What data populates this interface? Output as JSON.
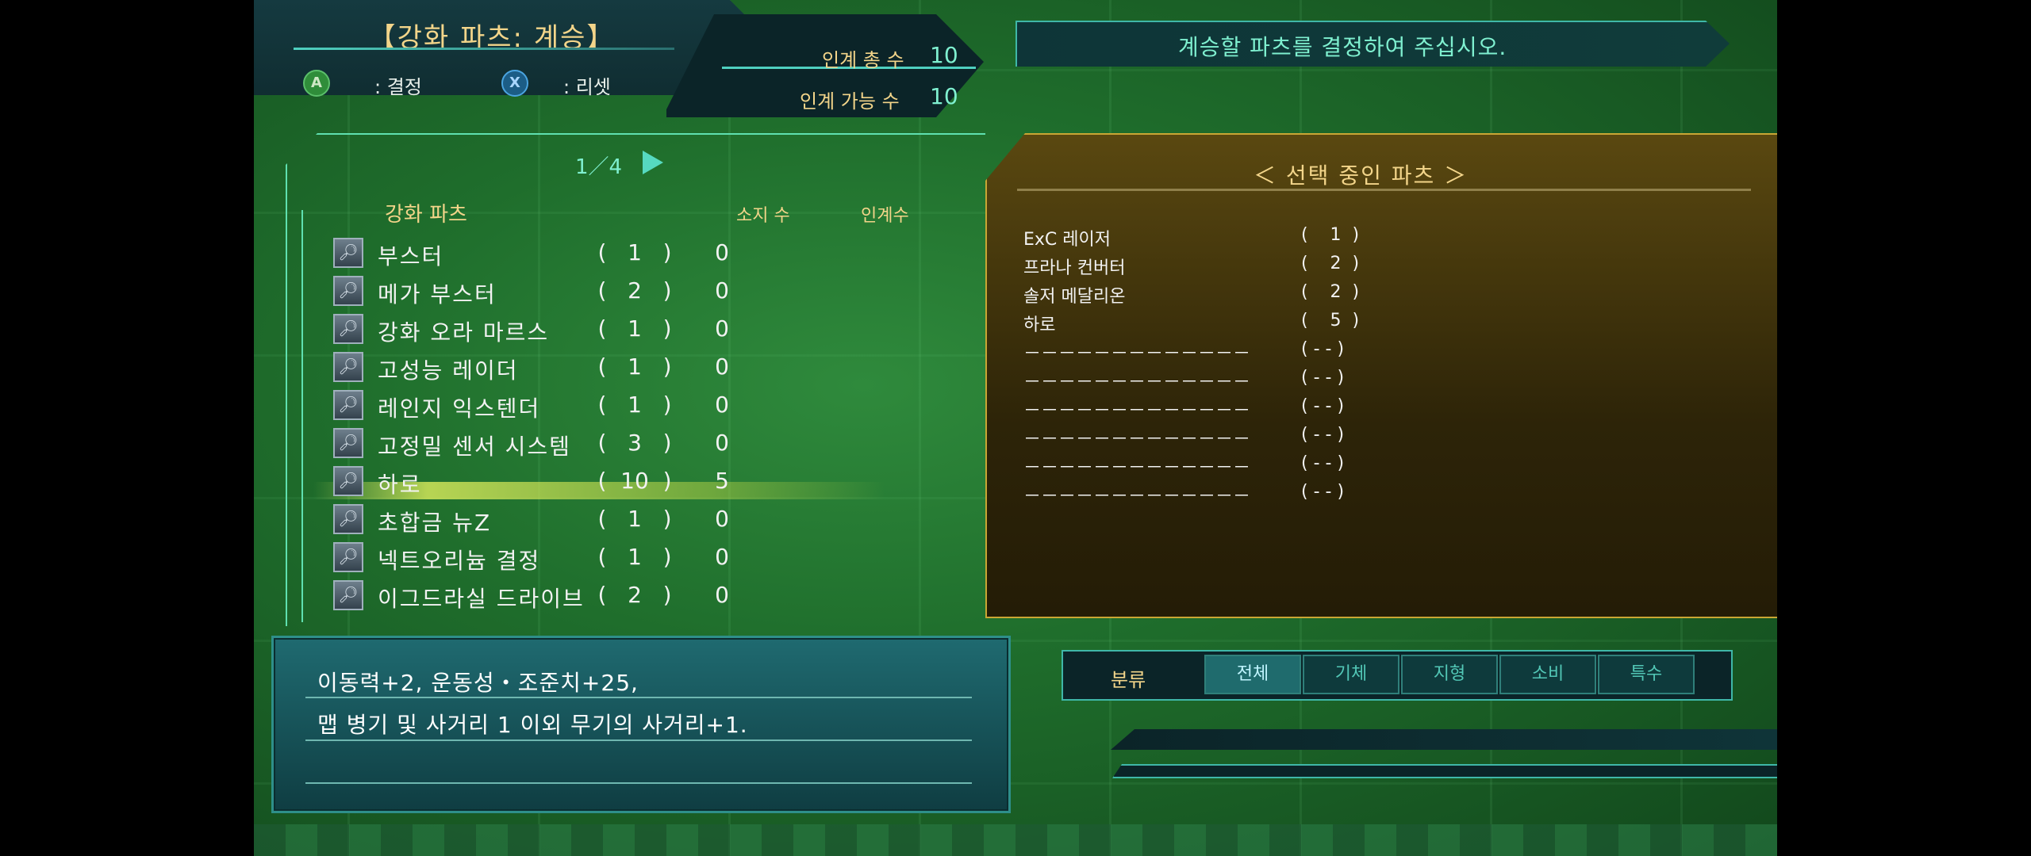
{
  "header": {
    "title": "【강화 파츠: 계승】",
    "controls": [
      {
        "button": "A",
        "label": ": 결정"
      },
      {
        "button": "X",
        "label": ": 리셋"
      }
    ],
    "total_label": "인계 총 수",
    "total_value": "10",
    "avail_label": "인계 가능 수",
    "avail_value": "10",
    "message": "계승할 파츠를 결정하여 주십시오."
  },
  "list": {
    "page": "1／4",
    "col_parts": "강화 파츠",
    "col_owned": "소지 수",
    "col_inherit": "인계수",
    "rows": [
      {
        "name": "부스터",
        "owned": "(   1   )",
        "inherit": "0"
      },
      {
        "name": "메가 부스터",
        "owned": "(   2   )",
        "inherit": "0"
      },
      {
        "name": "강화 오라 마르스",
        "owned": "(   1   )",
        "inherit": "0"
      },
      {
        "name": "고성능 레이더",
        "owned": "(   1   )",
        "inherit": "0"
      },
      {
        "name": "레인지 익스텐더",
        "owned": "(   1   )",
        "inherit": "0"
      },
      {
        "name": "고정밀 센서 시스템",
        "owned": "(   3   )",
        "inherit": "0"
      },
      {
        "name": "하로",
        "owned": "(  10  )",
        "inherit": "5"
      },
      {
        "name": "초합금 뉴Z",
        "owned": "(   1   )",
        "inherit": "0"
      },
      {
        "name": "넥트오리늄 결정",
        "owned": "(   1   )",
        "inherit": "0"
      },
      {
        "name": "이그드라실 드라이브",
        "owned": "(   2   )",
        "inherit": "0"
      }
    ],
    "selected_row": 6
  },
  "selected_panel": {
    "title": "＜  선택 중인 파츠  ＞",
    "rows": [
      {
        "name": "ExC 레이저",
        "count": "(    1  )"
      },
      {
        "name": "프라나 컨버터",
        "count": "(    2  )"
      },
      {
        "name": "솔저 메달리온",
        "count": "(    2  )"
      },
      {
        "name": "하로",
        "count": "(    5  )"
      },
      {
        "name": "－－－－－－－－－－－－－",
        "count": "( - - )"
      },
      {
        "name": "－－－－－－－－－－－－－",
        "count": "( - - )"
      },
      {
        "name": "－－－－－－－－－－－－－",
        "count": "( - - )"
      },
      {
        "name": "－－－－－－－－－－－－－",
        "count": "( - - )"
      },
      {
        "name": "－－－－－－－－－－－－－",
        "count": "( - - )"
      },
      {
        "name": "－－－－－－－－－－－－－",
        "count": "( - - )"
      }
    ]
  },
  "description": {
    "line1": "이동력+2, 운동성・조준치+25,",
    "line2": "맵 병기 및 사거리 1 이외 무기의 사거리+1."
  },
  "filter": {
    "label": "분류",
    "tabs": [
      "전체",
      "기체",
      "지형",
      "소비",
      "특수"
    ],
    "active": 0
  },
  "icons": {
    "row_icon": "lock-icon"
  }
}
